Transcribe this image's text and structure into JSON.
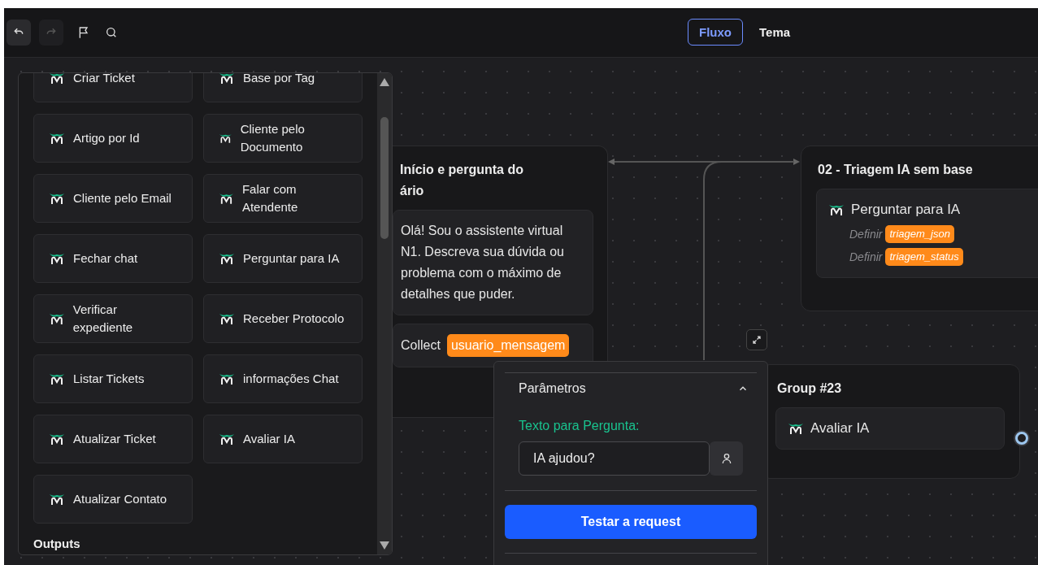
{
  "toolbar": {
    "undo": {
      "disabled": false
    },
    "redo": {
      "disabled": true
    },
    "tabs": [
      {
        "label": "Fluxo",
        "selected": true
      },
      {
        "label": "Tema",
        "selected": false
      }
    ]
  },
  "sidebar": {
    "items": [
      {
        "label": "Criar Ticket"
      },
      {
        "label": "Artigo por Id"
      },
      {
        "label": "Cliente pelo Email"
      },
      {
        "label": "Fechar chat"
      },
      {
        "label": "Verificar expediente"
      },
      {
        "label": "Listar Tickets"
      },
      {
        "label": "Atualizar Ticket"
      },
      {
        "label": "Atualizar Contato"
      },
      {
        "label": "Base por Tag"
      },
      {
        "label": "Cliente pelo Documento"
      },
      {
        "label": "Falar com Atendente"
      },
      {
        "label": "Perguntar para IA"
      },
      {
        "label": "Receber Protocolo"
      },
      {
        "label": "informações Chat"
      },
      {
        "label": "Avaliar IA"
      }
    ],
    "section_title": "Outputs"
  },
  "groups": [
    {
      "title_lines": [
        "Início e pergunta do",
        "ário"
      ],
      "blocks": [
        {
          "kind": "text",
          "text": "Olá! Sou o assistente virtual N1. Descreva sua dúvida ou problema com o máximo de detalhes que puder."
        },
        {
          "kind": "collect",
          "prefix": "Collect",
          "variable": "usuario_mensagem"
        }
      ]
    },
    {
      "title_lines": [
        "02 - Triagem IA sem base"
      ],
      "blocks": [
        {
          "kind": "integration",
          "label": "Perguntar para IA",
          "sets": [
            {
              "prefix": "Definir",
              "variable": "triagem_json"
            },
            {
              "prefix": "Definir",
              "variable": "triagem_status"
            }
          ]
        }
      ]
    },
    {
      "title_lines": [
        "Group #23"
      ],
      "blocks": [
        {
          "kind": "integration",
          "label": "Avaliar IA"
        }
      ]
    }
  ],
  "popover": {
    "section": {
      "title": "Parâmetros",
      "expanded": true
    },
    "field_label": "Texto para Pergunta:",
    "field_value": "IA ajudou?",
    "button": "Testar a request"
  }
}
